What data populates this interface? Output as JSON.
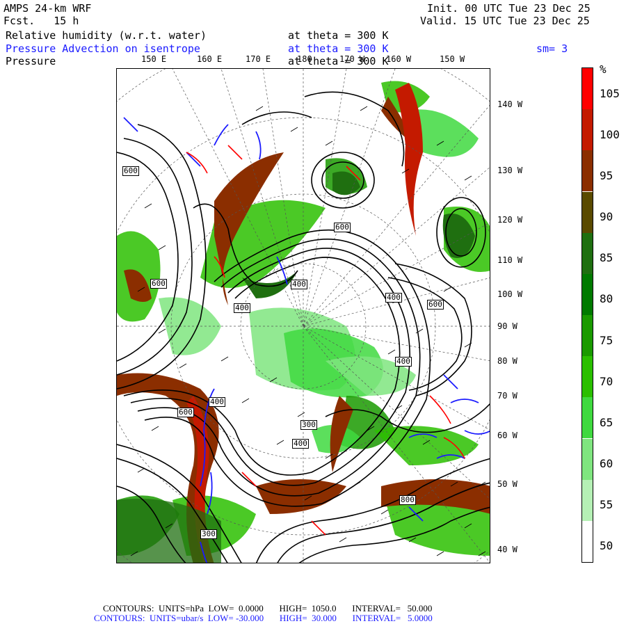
{
  "header": {
    "model": "AMPS 24-km WRF",
    "fcst": "Fcst.   15 h",
    "init": "Init. 00 UTC Tue 23 Dec 25",
    "valid": "Valid. 15 UTC Tue 23 Dec 25"
  },
  "fields": [
    {
      "name": "Relative humidity (w.r.t. water)",
      "level": "at theta = 300 K",
      "color": "#000000"
    },
    {
      "name": "Pressure Advection on isentrope",
      "level": "at theta = 300 K",
      "extra": "sm= 3",
      "color": "#1a1aff"
    },
    {
      "name": "Pressure",
      "level": "at theta = 300 K",
      "color": "#000000"
    }
  ],
  "top_lon_labels": [
    "150 E",
    "160 E",
    "170 E",
    "180",
    "170 W",
    "160 W",
    "150 W"
  ],
  "right_lon_labels": [
    "140 W",
    "130 W",
    "120 W",
    "110 W",
    "100 W",
    "90 W",
    "80 W",
    "70 W",
    "60 W",
    "50 W",
    "40 W"
  ],
  "contour_labels": [
    "600",
    "600",
    "600",
    "400",
    "400",
    "400",
    "400",
    "300",
    "400",
    "400",
    "600",
    "800",
    "300"
  ],
  "colorbar": {
    "unit": "%",
    "ticks": [
      "105",
      "100",
      "95",
      "90",
      "85",
      "80",
      "75",
      "70",
      "65",
      "60",
      "55",
      "50"
    ],
    "colors": [
      "#ff0000",
      "#c41a00",
      "#8b2e00",
      "#5a4a00",
      "#1f6f10",
      "#007a00",
      "#1a9a00",
      "#2bbf00",
      "#3fd93f",
      "#7fe57f",
      "#b5f0b5",
      "#ffffff"
    ]
  },
  "footer": {
    "line1": "CONTOURS:  UNITS=hPa  LOW=  0.0000       HIGH=  1050.0       INTERVAL=   50.000",
    "line2": "CONTOURS:  UNITS=ubar/s  LOW= -30.000       HIGH=  30.000       INTERVAL=   5.0000"
  }
}
